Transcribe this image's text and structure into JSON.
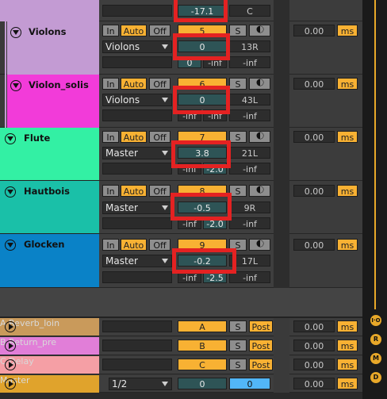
{
  "colors": {
    "accent_orange": "#f8b133",
    "selection_red": "#e42222"
  },
  "top_partial": {
    "volume": "-17.1",
    "pan": "C"
  },
  "tracks": [
    {
      "name": "Violons",
      "color": "#c39bd3",
      "in": "In",
      "auto": "Auto",
      "off": "Off",
      "number": "5",
      "solo": "S",
      "route": "Violons",
      "volume": "0",
      "pan": "13R",
      "level": "0",
      "peak_l": "-inf",
      "peak_r": "-inf",
      "delay": "0.00",
      "delay_unit": "ms"
    },
    {
      "name": "Violon_solis",
      "color": "#f23bd9",
      "in": "In",
      "auto": "Auto",
      "off": "Off",
      "number": "6",
      "solo": "S",
      "route": "Violons",
      "volume": "0",
      "pan": "43L",
      "level": "-inf",
      "peak_l": "-inf",
      "peak_r": "-inf",
      "delay": "0.00",
      "delay_unit": "ms"
    },
    {
      "name": "Flute",
      "color": "#33f0a4",
      "in": "In",
      "auto": "Auto",
      "off": "Off",
      "number": "7",
      "solo": "S",
      "route": "Master",
      "volume": "3.8",
      "pan": "21L",
      "level": "-inf",
      "peak_l": "-2.0",
      "peak_r": "-inf",
      "delay": "0.00",
      "delay_unit": "ms"
    },
    {
      "name": "Hautbois",
      "color": "#1ac0a8",
      "in": "In",
      "auto": "Auto",
      "off": "Off",
      "number": "8",
      "solo": "S",
      "route": "Master",
      "volume": "-0.5",
      "pan": "9R",
      "level": "-inf",
      "peak_l": "-2.0",
      "peak_r": "-inf",
      "delay": "0.00",
      "delay_unit": "ms"
    },
    {
      "name": "Glocken",
      "color": "#0a82c7",
      "in": "In",
      "auto": "Auto",
      "off": "Off",
      "number": "9",
      "solo": "S",
      "route": "Master",
      "volume": "-0.2",
      "pan": "17L",
      "level": "-inf",
      "peak_l": "-2.5",
      "peak_r": "-inf",
      "delay": "0.00",
      "delay_unit": "ms"
    }
  ],
  "returns": [
    {
      "name": "A Reverb_loin",
      "color": "#c99a5b",
      "letter": "A",
      "solo": "S",
      "post": "Post",
      "delay": "0.00",
      "delay_unit": "ms"
    },
    {
      "name": "B Return_pre",
      "color": "#e17ed8",
      "letter": "B",
      "solo": "S",
      "post": "Post",
      "delay": "0.00",
      "delay_unit": "ms"
    },
    {
      "name": "C Delay",
      "color": "#f59fa5",
      "letter": "C",
      "solo": "S",
      "post": "Post",
      "delay": "0.00",
      "delay_unit": "ms"
    }
  ],
  "master": {
    "name": "Master",
    "color": "#e0a32c",
    "route": "1/2",
    "volume": "0",
    "pan": "0",
    "delay": "0.00",
    "delay_unit": "ms"
  },
  "right_bar": {
    "io": "I·O",
    "r": "R",
    "m": "M",
    "d": "D"
  }
}
